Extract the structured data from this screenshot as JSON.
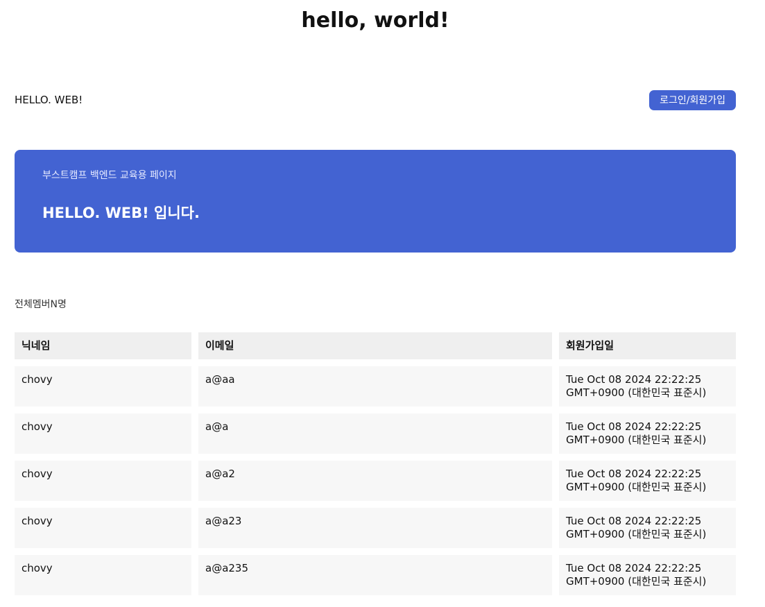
{
  "page": {
    "title": "hello, world!"
  },
  "header": {
    "brand": "HELLO. WEB!",
    "login_button": "로그인/회원가입"
  },
  "hero": {
    "subtitle": "부스트캠프 백엔드 교육용 페이지",
    "title": "HELLO. WEB! 입니다."
  },
  "members": {
    "count_label": "전체멤버N명",
    "columns": [
      "닉네임",
      "이메일",
      "회원가입일"
    ],
    "rows": [
      {
        "nickname": "chovy",
        "email": "a@aa",
        "joined": "Tue Oct 08 2024 22:22:25 GMT+0900 (대한민국 표준시)"
      },
      {
        "nickname": "chovy",
        "email": "a@a",
        "joined": "Tue Oct 08 2024 22:22:25 GMT+0900 (대한민국 표준시)"
      },
      {
        "nickname": "chovy",
        "email": "a@a2",
        "joined": "Tue Oct 08 2024 22:22:25 GMT+0900 (대한민국 표준시)"
      },
      {
        "nickname": "chovy",
        "email": "a@a23",
        "joined": "Tue Oct 08 2024 22:22:25 GMT+0900 (대한민국 표준시)"
      },
      {
        "nickname": "chovy",
        "email": "a@a235",
        "joined": "Tue Oct 08 2024 22:22:25 GMT+0900 (대한민국 표준시)"
      }
    ]
  },
  "colors": {
    "accent": "#4363d2",
    "header_cell_bg": "#efefef",
    "row_cell_bg": "#f7f7f7"
  }
}
